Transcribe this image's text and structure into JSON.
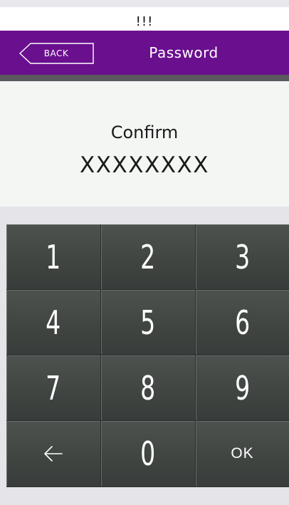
{
  "notice": {
    "text": "!!!"
  },
  "header": {
    "back_label": "BACK",
    "title": "Password"
  },
  "confirm": {
    "label": "Confirm",
    "value": "XXXXXXXX"
  },
  "keypad": {
    "keys": [
      {
        "label": "1"
      },
      {
        "label": "2"
      },
      {
        "label": "3"
      },
      {
        "label": "4"
      },
      {
        "label": "5"
      },
      {
        "label": "6"
      },
      {
        "label": "7"
      },
      {
        "label": "8"
      },
      {
        "label": "9"
      },
      {
        "icon": "back-arrow-icon"
      },
      {
        "label": "0"
      },
      {
        "label": "OK"
      }
    ]
  },
  "colors": {
    "header_bg": "#6a0f8e",
    "key_bg": "#434745",
    "panel_bg": "#f4f6f4"
  }
}
